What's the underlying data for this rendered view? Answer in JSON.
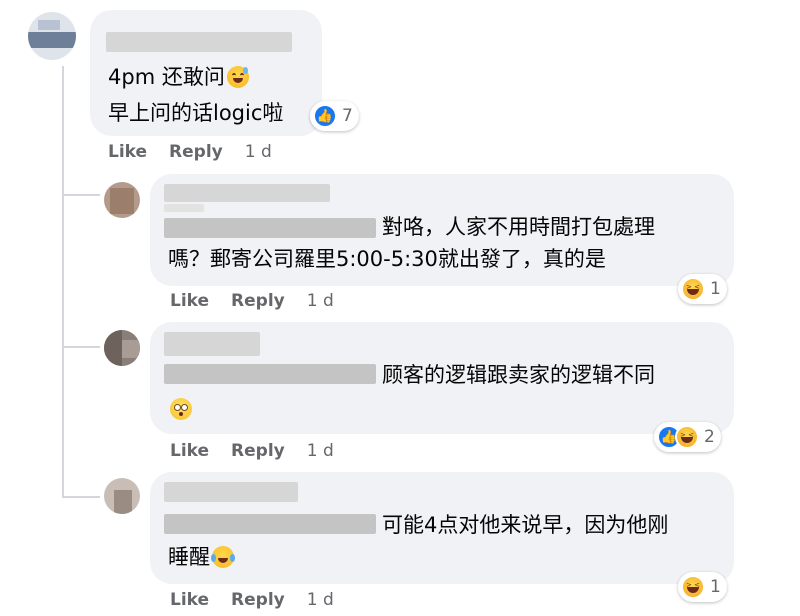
{
  "comments": [
    {
      "lines": [
        "4pm 还敢问",
        "早上问的话logic啦"
      ],
      "emojis": [
        "sweat-smile-emoji"
      ],
      "reaction_count": "7",
      "actions": {
        "like": "Like",
        "reply": "Reply",
        "time": "1 d"
      }
    },
    {
      "lines": [
        "對咯，人家不用時間打包處理",
        "嗎？郵寄公司羅里5:00-5:30就出發了，真的是"
      ],
      "reaction_count": "1",
      "actions": {
        "like": "Like",
        "reply": "Reply",
        "time": "1 d"
      }
    },
    {
      "lines": [
        "顾客的逻辑跟卖家的逻辑不同"
      ],
      "emojis": [
        "flushed-emoji"
      ],
      "reaction_count": "2",
      "actions": {
        "like": "Like",
        "reply": "Reply",
        "time": "1 d"
      }
    },
    {
      "lines": [
        "可能4点对他来说早，因为他刚",
        "睡醒"
      ],
      "emojis": [
        "tears-of-joy-emoji"
      ],
      "reaction_count": "1",
      "actions": {
        "like": "Like",
        "reply": "Reply",
        "time": "1 d"
      }
    }
  ],
  "colors": {
    "bubble": "#f0f2f5",
    "action_text": "#65676b",
    "like_blue": "#1877f2",
    "thread_line": "#d3d6db"
  }
}
